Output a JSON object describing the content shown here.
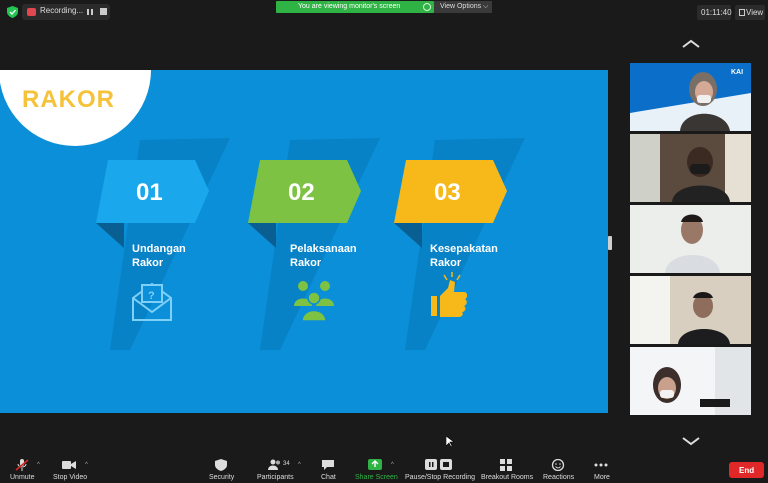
{
  "topbar": {
    "recording_label": "Recording...",
    "share_banner": "You are viewing monitor's screen",
    "view_options": "View Options ⌵",
    "timer": "01:11:40",
    "view_label": "View"
  },
  "slide": {
    "title": "RAKOR",
    "steps": [
      {
        "number": "01",
        "line1": "Undangan",
        "line2": "Rakor",
        "color": "#1aa7ec",
        "icon": "envelope-question-icon"
      },
      {
        "number": "02",
        "line1": "Pelaksanaan",
        "line2": "Rakor",
        "color": "#7dc242",
        "icon": "people-group-icon"
      },
      {
        "number": "03",
        "line1": "Kesepakatan",
        "line2": "Rakor",
        "color": "#f6b919",
        "icon": "thumbs-up-icon"
      }
    ]
  },
  "gallery": {
    "tile1_logo": "KAI",
    "participant_tiles": 5
  },
  "toolbar": {
    "unmute": "Unmute",
    "stop_video": "Stop Video",
    "security": "Security",
    "participants": "Participants",
    "participant_count": "34",
    "chat": "Chat",
    "share_screen": "Share Screen",
    "pause_stop_recording": "Pause/Stop Recording",
    "breakout_rooms": "Breakout Rooms",
    "reactions": "Reactions",
    "more": "More",
    "end": "End"
  },
  "colors": {
    "slide_bg": "#0a8fd8",
    "share_green": "#2fb344",
    "end_red": "#e02828",
    "title_yellow": "#f6c23a"
  }
}
